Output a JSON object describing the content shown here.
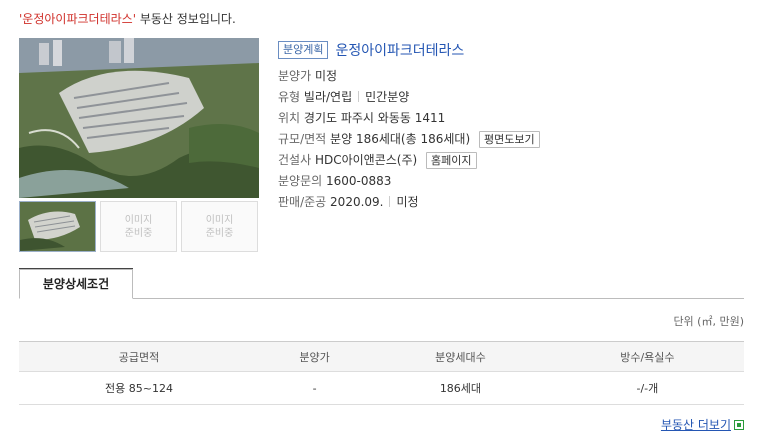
{
  "headline": {
    "name_quoted": "'운정아이파크더테라스'",
    "suffix": " 부동산 정보입니다."
  },
  "gallery": {
    "placeholder_line1": "이미지",
    "placeholder_line2": "준비중"
  },
  "listing": {
    "badge": "분양계획",
    "title": "운정아이파크더테라스",
    "price_label": "분양가",
    "price_value": "미정",
    "type_label": "유형",
    "type_value": "빌라/연립",
    "type_value2": "민간분양",
    "location_label": "위치",
    "location_value": "경기도 파주시 와동동 1411",
    "scale_label": "규모/면적",
    "scale_value": "분양 186세대(총 186세대)",
    "floorplan_button": "평면도보기",
    "builder_label": "건설사",
    "builder_value": "HDC아이앤콘스(주)",
    "homepage_button": "홈페이지",
    "inquiry_label": "분양문의",
    "inquiry_value": "1600-0883",
    "sale_label": "판매/준공",
    "sale_value": "2020.09.",
    "completion_value": "미정"
  },
  "tabs": {
    "detail": "분양상세조건"
  },
  "unit_note": "단위 (㎡, 만원)",
  "table": {
    "headers": [
      "공급면적",
      "분양가",
      "분양세대수",
      "방수/욕실수"
    ],
    "rows": [
      [
        "전용 85~124",
        "-",
        "186세대",
        "-/-개"
      ]
    ]
  },
  "more_link": "부동산 더보기"
}
